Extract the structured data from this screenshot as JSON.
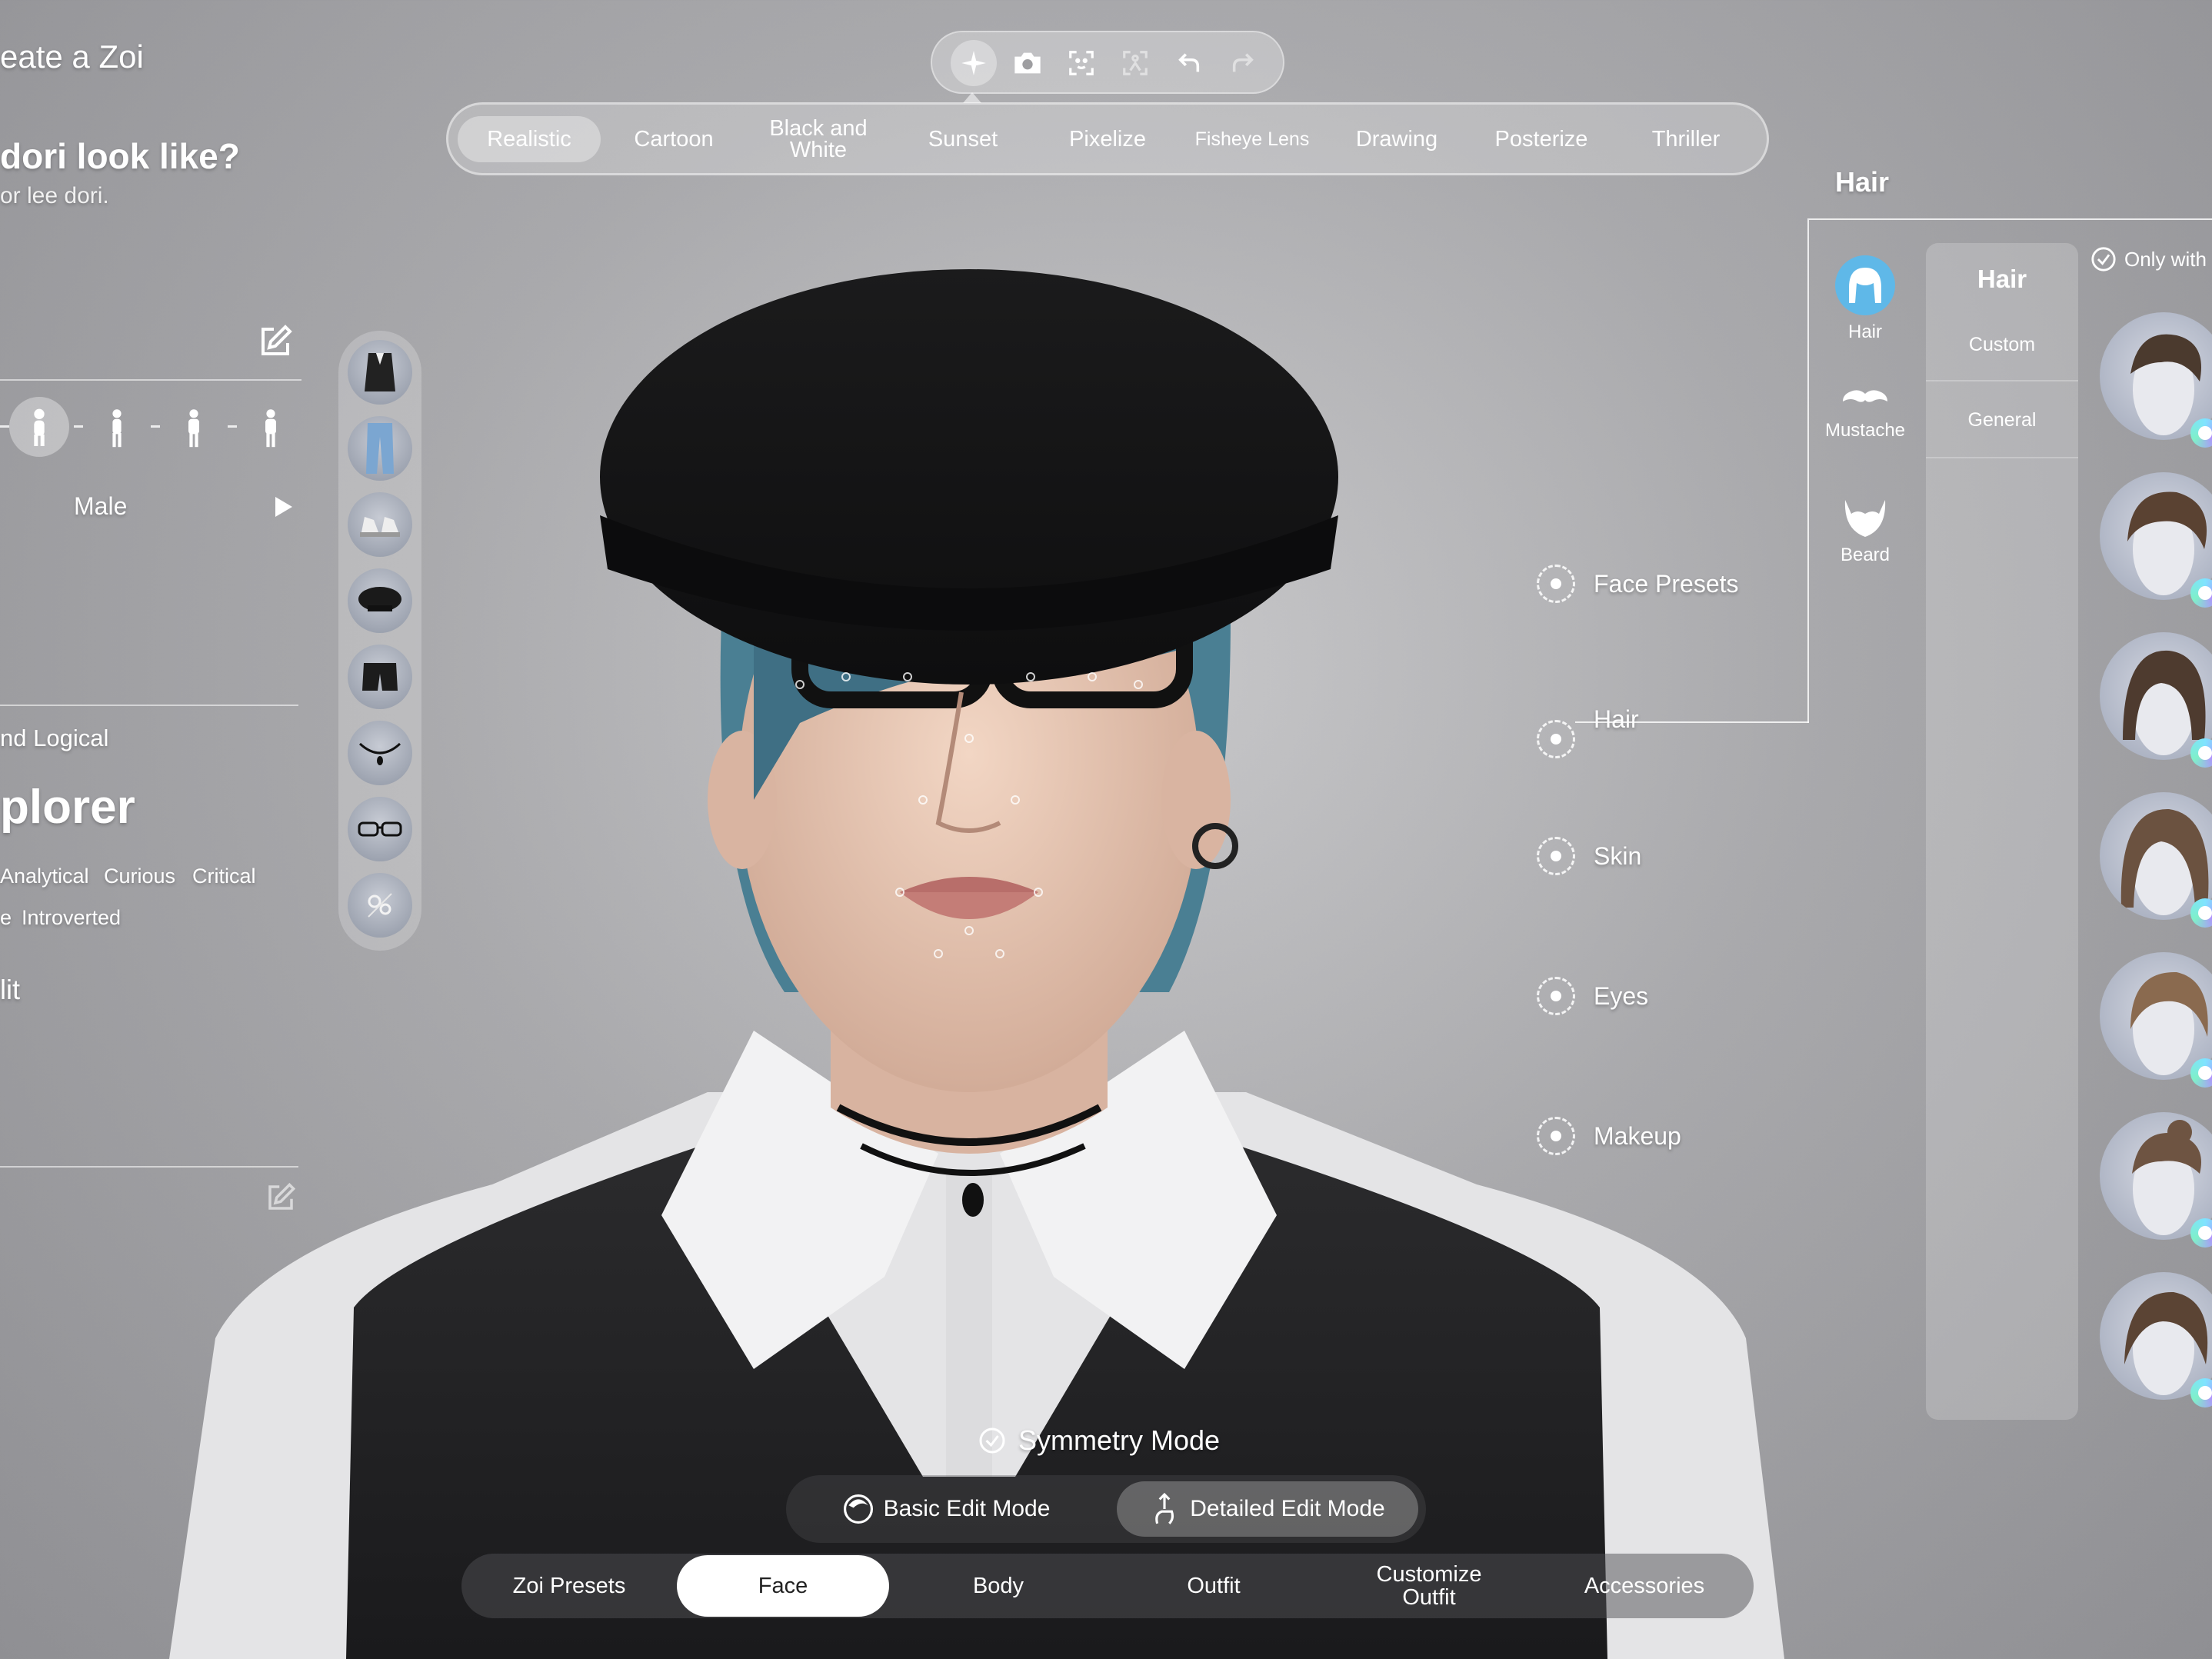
{
  "left_panel": {
    "title": "eate a Zoi",
    "question": "dori look like?",
    "subtitle": "or lee dori.",
    "gender": "Male",
    "trait_heading": "nd Logical",
    "personality": "plorer",
    "traits_row1": [
      "Analytical",
      "Curious",
      "Critical"
    ],
    "traits_row2": [
      "e",
      "Introverted"
    ],
    "section_label": "lit"
  },
  "toolbar": {
    "buttons": [
      "sparkle-icon",
      "camera-icon",
      "face-scan-icon",
      "body-scan-icon",
      "undo-icon",
      "redo-icon"
    ]
  },
  "filters": [
    "Realistic",
    "Cartoon",
    "Black and\nWhite",
    "Sunset",
    "Pixelize",
    "Fisheye Lens",
    "Drawing",
    "Posterize",
    "Thriller"
  ],
  "active_filter": "Realistic",
  "anchors": [
    "Face Presets",
    "Hair",
    "Skin",
    "Eyes",
    "Makeup"
  ],
  "right_panel": {
    "heading": "Hair",
    "categories": [
      "Hair",
      "Mustache",
      "Beard"
    ],
    "sub_heading": "Hair",
    "sub_items": [
      "Custom",
      "General"
    ],
    "filter_label": "Only with",
    "hair_count": 7
  },
  "symmetry_label": "Symmetry Mode",
  "edit_modes": [
    "Basic Edit Mode",
    "Detailed Edit Mode"
  ],
  "main_tabs": [
    "Zoi Presets",
    "Face",
    "Body",
    "Outfit",
    "Customize\nOutfit",
    "Accessories"
  ],
  "active_tab": "Face",
  "colors": {
    "accent_hair": "#5fb8e8",
    "background": "#a9a9ac",
    "active_tab_bg": "#ffffff"
  }
}
